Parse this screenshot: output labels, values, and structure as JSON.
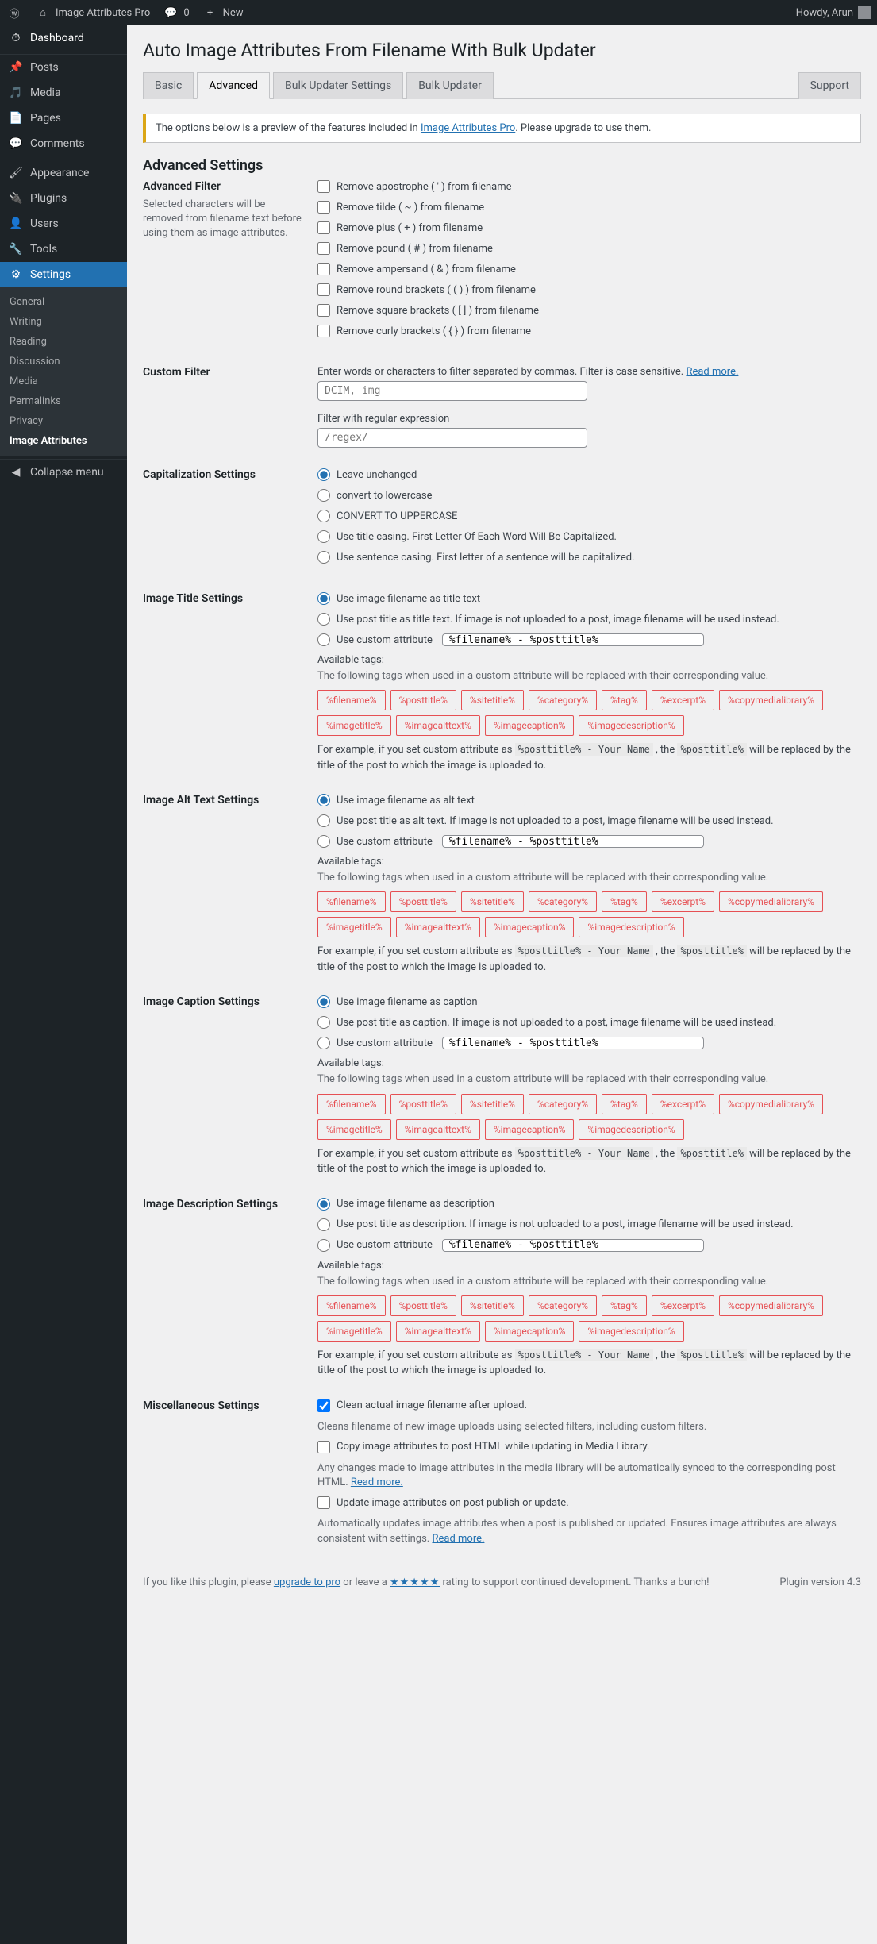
{
  "adminbar": {
    "site": "Image Attributes Pro",
    "comments": "0",
    "new": "New",
    "howdy": "Howdy, Arun"
  },
  "menu": {
    "dashboard": "Dashboard",
    "posts": "Posts",
    "media": "Media",
    "pages": "Pages",
    "comments": "Comments",
    "appearance": "Appearance",
    "plugins": "Plugins",
    "users": "Users",
    "tools": "Tools",
    "settings": "Settings",
    "collapse": "Collapse menu"
  },
  "submenu": {
    "general": "General",
    "writing": "Writing",
    "reading": "Reading",
    "discussion": "Discussion",
    "media": "Media",
    "permalinks": "Permalinks",
    "privacy": "Privacy",
    "image_attributes": "Image Attributes"
  },
  "page": {
    "h1": "Auto Image Attributes From Filename With Bulk Updater",
    "h2": "Advanced Settings"
  },
  "tabs": {
    "basic": "Basic",
    "advanced": "Advanced",
    "bulk_settings": "Bulk Updater Settings",
    "bulk_updater": "Bulk Updater",
    "support": "Support"
  },
  "notice": {
    "pre": "The options below is a preview of the features included in ",
    "link": "Image Attributes Pro",
    "post": ". Please upgrade to use them."
  },
  "filter": {
    "title": "Advanced Filter",
    "desc": "Selected characters will be removed from filename text before using them as image attributes.",
    "items": [
      "Remove apostrophe ( ' ) from filename",
      "Remove tilde ( ~ ) from filename",
      "Remove plus ( + ) from filename",
      "Remove pound ( # ) from filename",
      "Remove ampersand ( & ) from filename",
      "Remove round brackets ( ( ) ) from filename",
      "Remove square brackets ( [ ] ) from filename",
      "Remove curly brackets ( { } ) from filename"
    ]
  },
  "custom": {
    "title": "Custom Filter",
    "lbl1": "Enter words or characters to filter separated by commas. Filter is case sensitive. ",
    "read": "Read more.",
    "ph1": "DCIM, img",
    "lbl2": "Filter with regular expression",
    "ph2": "/regex/"
  },
  "cap": {
    "title": "Capitalization Settings",
    "items": [
      "Leave unchanged",
      "convert to lowercase",
      "CONVERT TO UPPERCASE",
      "Use title casing. First Letter Of Each Word Will Be Capitalized.",
      "Use sentence casing. First letter of a sentence will be capitalized."
    ]
  },
  "sect": [
    {
      "title": "Image Title Settings",
      "r1": "Use image filename as title text",
      "r2": "Use post title as title text. If image is not uploaded to a post, image filename will be used instead.",
      "r3": "Use custom attribute",
      "val": "%filename% - %posttitle%"
    },
    {
      "title": "Image Alt Text Settings",
      "r1": "Use image filename as alt text",
      "r2": "Use post title as alt text. If image is not uploaded to a post, image filename will be used instead.",
      "r3": "Use custom attribute",
      "val": "%filename% - %posttitle%"
    },
    {
      "title": "Image Caption Settings",
      "r1": "Use image filename as caption",
      "r2": "Use post title as caption. If image is not uploaded to a post, image filename will be used instead.",
      "r3": "Use custom attribute",
      "val": "%filename% - %posttitle%"
    },
    {
      "title": "Image Description Settings",
      "r1": "Use image filename as description",
      "r2": "Use post title as description. If image is not uploaded to a post, image filename will be used instead.",
      "r3": "Use custom attribute",
      "val": "%filename% - %posttitle%"
    }
  ],
  "avail": {
    "h": "Available tags:",
    "d": "The following tags when used in a custom attribute will be replaced with their corresponding value.",
    "tags": [
      "%filename%",
      "%posttitle%",
      "%sitetitle%",
      "%category%",
      "%tag%",
      "%excerpt%",
      "%copymedialibrary%",
      "%imagetitle%",
      "%imagealttext%",
      "%imagecaption%",
      "%imagedescription%"
    ],
    "ex1": "For example, if you set custom attribute as ",
    "code1": "%posttitle% - Your Name",
    "ex2": " , the ",
    "code2": "%posttitle%",
    "ex3": " will be replaced by the title of the post to which the image is uploaded to."
  },
  "misc": {
    "title": "Miscellaneous Settings",
    "c1": "Clean actual image filename after upload.",
    "h1": "Cleans filename of new image uploads using selected filters, including custom filters.",
    "c2": "Copy image attributes to post HTML while updating in Media Library.",
    "h2a": "Any changes made to image attributes in the media library will be automatically synced to the corresponding post HTML. ",
    "read": "Read more.",
    "c3": "Update image attributes on post publish or update.",
    "h3a": "Automatically updates image attributes when a post is published or updated. Ensures image attributes are always consistent with settings. "
  },
  "footer": {
    "pre": "If you like this plugin, please ",
    "upgrade": "upgrade to pro",
    "mid": " or leave a ",
    "post": " rating to support continued development. Thanks a bunch!",
    "ver": "Plugin version 4.3"
  }
}
